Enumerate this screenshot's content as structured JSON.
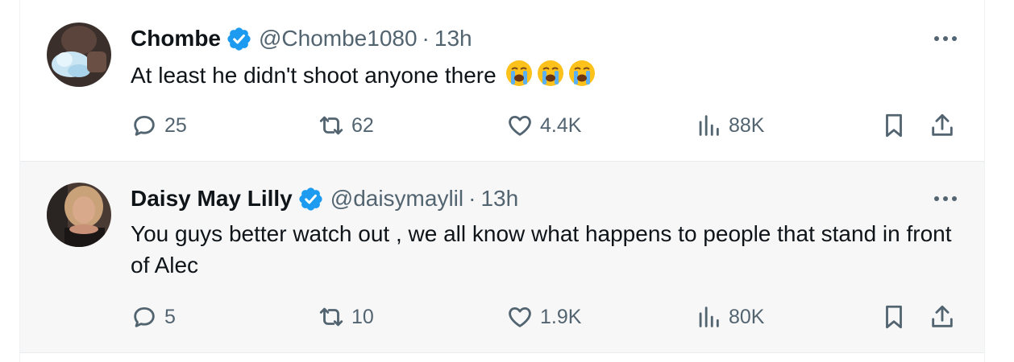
{
  "tweets": [
    {
      "name": "Chombe",
      "handle": "@Chombe1080",
      "sep": "·",
      "time": "13h",
      "text": "At least he didn't shoot anyone there",
      "emojis": [
        "loudly-crying-face",
        "loudly-crying-face",
        "loudly-crying-face"
      ],
      "replies": "25",
      "retweets": "62",
      "likes": "4.4K",
      "views": "88K"
    },
    {
      "name": "Daisy May Lilly",
      "handle": "@daisymaylil",
      "sep": "·",
      "time": "13h",
      "text": "You guys better watch out , we all know what happens to people that stand in front of Alec",
      "replies": "5",
      "retweets": "10",
      "likes": "1.9K",
      "views": "80K"
    }
  ],
  "colors": {
    "verified": "#1d9bf0",
    "text": "#0f1419",
    "muted": "#536471",
    "highlight_bg": "#f7f7f7"
  }
}
